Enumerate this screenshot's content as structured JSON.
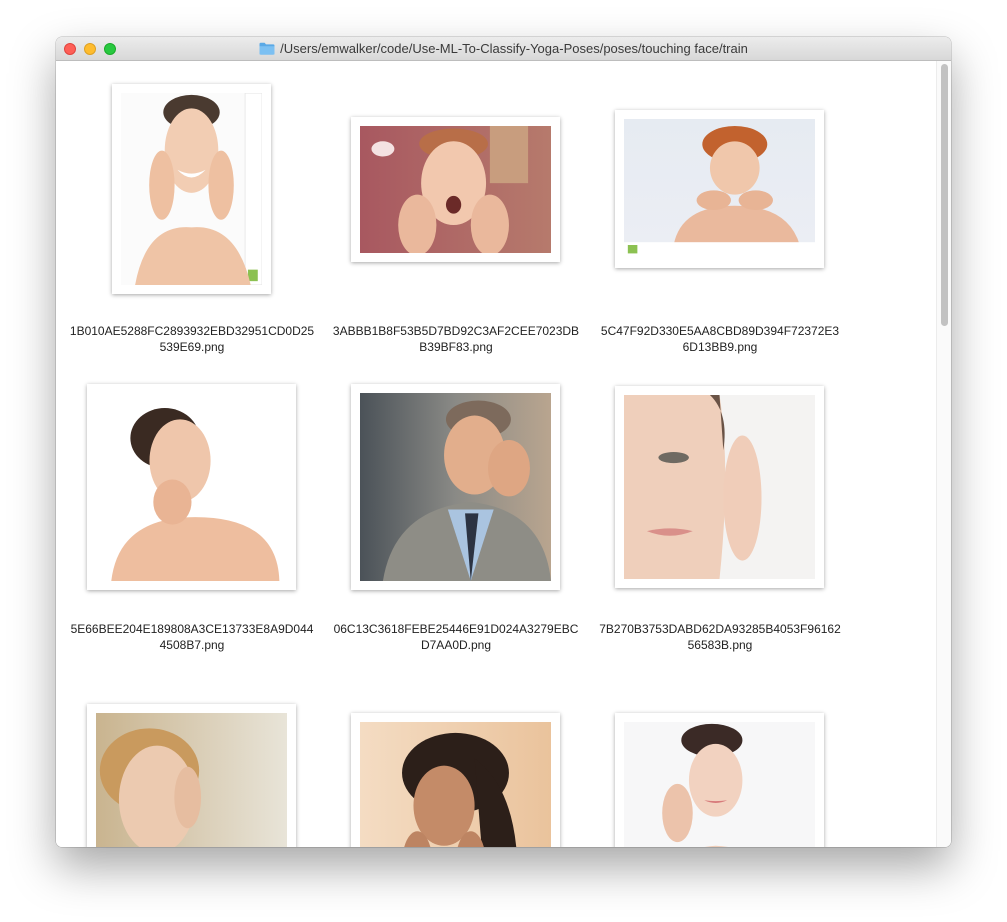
{
  "window": {
    "title": "/Users/emwalker/code/Use-ML-To-Classify-Yoga-Poses/poses/touching face/train",
    "folder_icon": "folder-icon"
  },
  "files": [
    {
      "name_line1": "1B010AE5288FC2893932EBD32951CD0D25",
      "name_line2": "539E69.png",
      "depicts": "woman-winking-hands-on-cheeks"
    },
    {
      "name_line1": "3ABBB1B8F53B5D7BD92C3AF2CEE7023DB",
      "name_line2": "B39BF83.png",
      "depicts": "boy-screaming-hands-on-face"
    },
    {
      "name_line1": "5C47F92D330E5AA8CBD89D394F72372E3",
      "name_line2": "6D13BB9.png",
      "depicts": "woman-chin-on-hands"
    },
    {
      "name_line1": "5E66BEE204E189808A3CE13733E8A9D044",
      "name_line2": "4508B7.png",
      "depicts": "woman-eyes-closed-hand-on-jaw"
    },
    {
      "name_line1": "06C13C3618FEBE25446E91D024A3279EBC",
      "name_line2": "D7AA0D.png",
      "depicts": "man-in-suit-hand-on-forehead"
    },
    {
      "name_line1": "7B270B3753DABD62DA93285B4053F96162",
      "name_line2": "56583B.png",
      "depicts": "woman-half-face-hand-on-temple"
    },
    {
      "name_line1": "",
      "name_line2": "",
      "depicts": "woman-looking-up-hand-on-temple"
    },
    {
      "name_line1": "",
      "name_line2": "",
      "depicts": "woman-laughing-hands-on-cheeks"
    },
    {
      "name_line1": "",
      "name_line2": "",
      "depicts": "woman-hands-near-face"
    }
  ],
  "colors": {
    "close": "#fe5f57",
    "minimize": "#febc2e",
    "maximize": "#28c840",
    "folder": "#5aa9e6"
  }
}
